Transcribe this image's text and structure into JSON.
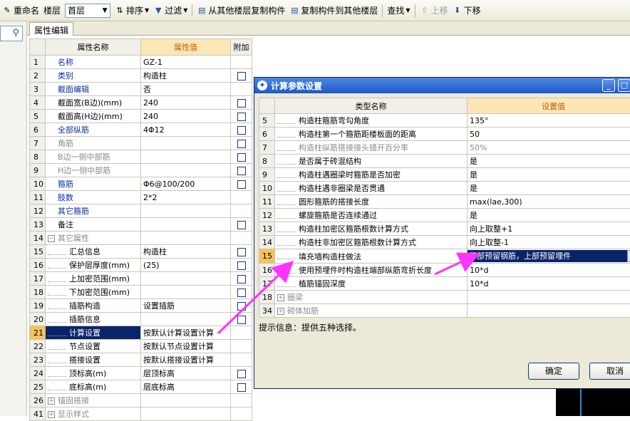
{
  "toolbar": {
    "rename": "重命名",
    "floor_label": "楼层",
    "floor_value": "首层",
    "sort": "排序",
    "filter": "过滤",
    "copy_from": "从其他楼层复制构件",
    "copy_to": "复制构件到其他楼层",
    "find": "查找",
    "move_up": "上移",
    "move_down": "下移"
  },
  "tab_label": "属性编辑",
  "attr_table": {
    "headers": [
      "属性名称",
      "属性值",
      "附加"
    ],
    "rows": [
      {
        "n": "1",
        "name": "名称",
        "value": "GZ-1",
        "style": "blue",
        "check": false,
        "indent": 0
      },
      {
        "n": "2",
        "name": "类别",
        "value": "构造柱",
        "style": "blue",
        "check": true,
        "indent": 0
      },
      {
        "n": "3",
        "name": "截面编辑",
        "value": "否",
        "style": "blue",
        "check": false,
        "indent": 0
      },
      {
        "n": "4",
        "name": "截面宽(B边)(mm)",
        "value": "240",
        "style": "normal",
        "check": true,
        "indent": 0
      },
      {
        "n": "5",
        "name": "截面高(H边)(mm)",
        "value": "240",
        "style": "normal",
        "check": true,
        "indent": 0
      },
      {
        "n": "6",
        "name": "全部纵筋",
        "value": "4Φ12",
        "style": "blue",
        "check": true,
        "indent": 0
      },
      {
        "n": "7",
        "name": "角筋",
        "value": "",
        "style": "gray",
        "check": true,
        "indent": 0
      },
      {
        "n": "8",
        "name": "B边一侧中部筋",
        "value": "",
        "style": "gray",
        "check": true,
        "indent": 0
      },
      {
        "n": "9",
        "name": "H边一侧中部筋",
        "value": "",
        "style": "gray",
        "check": true,
        "indent": 0
      },
      {
        "n": "10",
        "name": "箍筋",
        "value": "Φ6@100/200",
        "style": "blue",
        "check": true,
        "indent": 0
      },
      {
        "n": "11",
        "name": "肢数",
        "value": "2*2",
        "style": "blue",
        "check": false,
        "indent": 0
      },
      {
        "n": "12",
        "name": "其它箍筋",
        "value": "",
        "style": "blue",
        "check": false,
        "indent": 0
      },
      {
        "n": "13",
        "name": "备注",
        "value": "",
        "style": "normal",
        "check": true,
        "indent": 0
      },
      {
        "n": "14",
        "name": "其它属性",
        "value": "",
        "style": "gray",
        "check": false,
        "indent": 0,
        "expand": "−"
      },
      {
        "n": "15",
        "name": "汇总信息",
        "value": "构造柱",
        "style": "normal",
        "check": true,
        "indent": 1
      },
      {
        "n": "16",
        "name": "保护层厚度(mm)",
        "value": "(25)",
        "style": "normal",
        "check": true,
        "indent": 1
      },
      {
        "n": "17",
        "name": "上加密范围(mm)",
        "value": "",
        "style": "normal",
        "check": true,
        "indent": 1
      },
      {
        "n": "18",
        "name": "下加密范围(mm)",
        "value": "",
        "style": "normal",
        "check": true,
        "indent": 1
      },
      {
        "n": "19",
        "name": "插筋构造",
        "value": "设置插筋",
        "style": "normal",
        "check": true,
        "indent": 1
      },
      {
        "n": "20",
        "name": "插筋信息",
        "value": "",
        "style": "normal",
        "check": true,
        "indent": 1
      },
      {
        "n": "21",
        "name": "计算设置",
        "value": "按默认计算设置计算",
        "style": "normal",
        "check": false,
        "indent": 1,
        "selected": true
      },
      {
        "n": "22",
        "name": "节点设置",
        "value": "按默认节点设置计算",
        "style": "normal",
        "check": false,
        "indent": 1
      },
      {
        "n": "23",
        "name": "搭接设置",
        "value": "按默认搭接设置计算",
        "style": "normal",
        "check": false,
        "indent": 1
      },
      {
        "n": "24",
        "name": "顶标高(m)",
        "value": "层顶标高",
        "style": "normal",
        "check": true,
        "indent": 1
      },
      {
        "n": "25",
        "name": "底标高(m)",
        "value": "层底标高",
        "style": "normal",
        "check": true,
        "indent": 1
      },
      {
        "n": "26",
        "name": "锚固搭接",
        "value": "",
        "style": "gray",
        "check": false,
        "indent": 0,
        "expand": "+"
      },
      {
        "n": "41",
        "name": "显示样式",
        "value": "",
        "style": "gray",
        "check": false,
        "indent": 0,
        "expand": "+"
      }
    ]
  },
  "dialog": {
    "title": "计算参数设置",
    "headers": [
      "类型名称",
      "设置值"
    ],
    "rows": [
      {
        "n": "5",
        "name": "构造柱箍筋弯勾角度",
        "value": "135°",
        "style": "normal"
      },
      {
        "n": "6",
        "name": "构造柱第一个箍筋距楼板面的距离",
        "value": "50",
        "style": "normal"
      },
      {
        "n": "7",
        "name": "构造柱纵筋搭接接头错开百分率",
        "value": "50%",
        "style": "gray"
      },
      {
        "n": "8",
        "name": "是否属于砖混结构",
        "value": "是",
        "style": "normal"
      },
      {
        "n": "9",
        "name": "构造柱遇圈梁时箍筋是否加密",
        "value": "是",
        "style": "normal"
      },
      {
        "n": "10",
        "name": "构造柱遇非圈梁是否贯通",
        "value": "是",
        "style": "normal"
      },
      {
        "n": "11",
        "name": "圆形箍筋的搭接长度",
        "value": "max(lae,300)",
        "style": "normal"
      },
      {
        "n": "12",
        "name": "螺旋箍筋是否连续通过",
        "value": "是",
        "style": "normal"
      },
      {
        "n": "13",
        "name": "构造柱加密区箍筋根数计算方式",
        "value": "向上取整+1",
        "style": "normal"
      },
      {
        "n": "14",
        "name": "构造柱非加密区箍筋根数计算方式",
        "value": "向上取整-1",
        "style": "normal"
      },
      {
        "n": "15",
        "name": "填充墙构造柱做法",
        "value": "下部预留钢筋，上部预留埋件",
        "style": "edit"
      },
      {
        "n": "16",
        "name": "使用预埋件时构造柱端部纵筋弯折长度",
        "value": "10*d",
        "style": "normal"
      },
      {
        "n": "17",
        "name": "植筋锚固深度",
        "value": "10*d",
        "style": "normal"
      },
      {
        "n": "18",
        "name": "圈梁",
        "value": "",
        "style": "group"
      },
      {
        "n": "34",
        "name": "砌体加筋",
        "value": "",
        "style": "group"
      }
    ],
    "hint": "提示信息：提供五种选择。",
    "ok": "确定",
    "cancel": "取消"
  },
  "colors": {
    "selection": "#0a246a",
    "accent_header": "#fbe7b6",
    "annotation_arrow": "#ff00ff"
  }
}
